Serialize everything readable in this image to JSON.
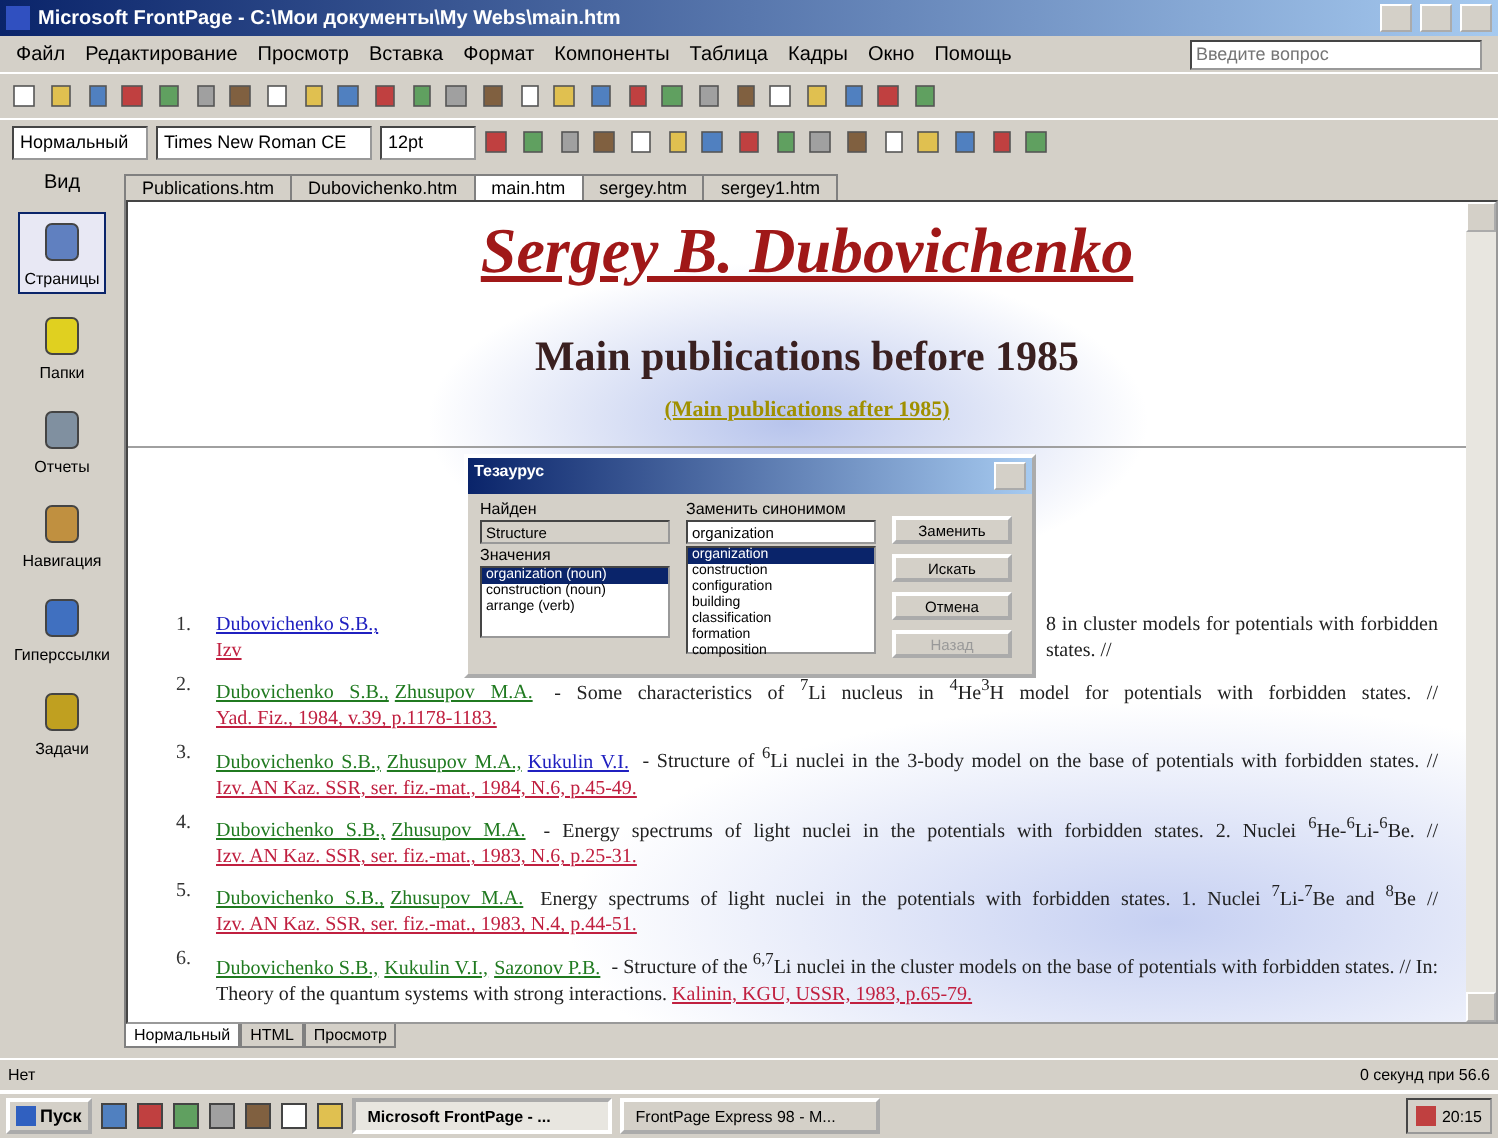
{
  "window": {
    "title": "Microsoft FrontPage - C:\\Мои документы\\My Webs\\main.htm"
  },
  "menu": [
    "Файл",
    "Редактирование",
    "Просмотр",
    "Вставка",
    "Формат",
    "Компоненты",
    "Таблица",
    "Кадры",
    "Окно",
    "Помощь"
  ],
  "help_field": {
    "placeholder": "Введите вопрос"
  },
  "format_bar": {
    "style": "Нормальный",
    "font": "Times New Roman CE",
    "size": "12pt"
  },
  "views": {
    "label": "Вид",
    "items": [
      {
        "label": "Страницы",
        "selected": true
      },
      {
        "label": "Папки",
        "selected": false
      },
      {
        "label": "Отчеты",
        "selected": false
      },
      {
        "label": "Навигация",
        "selected": false
      },
      {
        "label": "Гиперссылки",
        "selected": false
      },
      {
        "label": "Задачи",
        "selected": false
      }
    ]
  },
  "doc_tabs": [
    {
      "label": "Publications.htm",
      "selected": false
    },
    {
      "label": "Dubovichenko.htm",
      "selected": false
    },
    {
      "label": "main.htm",
      "selected": true
    },
    {
      "label": "sergey.htm",
      "selected": false
    },
    {
      "label": "sergey1.htm",
      "selected": false
    }
  ],
  "page": {
    "name": "Sergey B. Dubovichenko",
    "heading": "Main publications before 1985",
    "other_link": "(Main publications after 1985)",
    "items": [
      {
        "number": "1.",
        "authors": [
          {
            "text": "Dubovichenko S.B.,",
            "visited": false
          }
        ],
        "text": "8 in cluster models for potentials with forbidden states. //",
        "source": "Izv",
        "covered": true
      },
      {
        "number": "2.",
        "authors": [
          {
            "text": "Dubovichenko S.B.,",
            "visited": true
          },
          {
            "text": "Zhusupov M.A.",
            "visited": true
          }
        ],
        "text": "- Some characteristics of $^{7}$Li nucleus in $^{4}$He$^{3}$H model for potentials with forbidden states. //",
        "source": "Yad. Fiz., 1984, v.39, p.1178-1183.",
        "covered": false
      },
      {
        "number": "3.",
        "authors": [
          {
            "text": "Dubovichenko S.B.,",
            "visited": true
          },
          {
            "text": "Zhusupov M.A.,",
            "visited": true
          },
          {
            "text": "Kukulin V.I.",
            "visited": false
          }
        ],
        "text": "- Structure of $^{6}$Li nuclei in the 3-body model on the base of potentials with forbidden states. //",
        "source": "Izv. AN Kaz. SSR, ser. fiz.-mat., 1984, N.6, p.45-49.",
        "covered": false
      },
      {
        "number": "4.",
        "authors": [
          {
            "text": "Dubovichenko S.B.,",
            "visited": true
          },
          {
            "text": "Zhusupov M.A.",
            "visited": true
          }
        ],
        "text": "- Energy spectrums of light nuclei in the potentials with forbidden states. 2. Nuclei $^{6}$He-$^{6}$Li-$^{6}$Be. //",
        "source": "Izv. AN Kaz. SSR, ser. fiz.-mat., 1983, N.6, p.25-31.",
        "covered": false
      },
      {
        "number": "5.",
        "authors": [
          {
            "text": "Dubovichenko S.B.,",
            "visited": true
          },
          {
            "text": "Zhusupov M.A.",
            "visited": true
          }
        ],
        "text": "Energy spectrums of light nuclei in the potentials with forbidden states. 1. Nuclei $^{7}$Li-$^{7}$Be and $^{8}$Be //",
        "source": "Izv. AN Kaz. SSR, ser. fiz.-mat., 1983, N.4, p.44-51.",
        "covered": false
      },
      {
        "number": "6.",
        "authors": [
          {
            "text": "Dubovichenko S.B.,",
            "visited": true
          },
          {
            "text": "Kukulin V.I.,",
            "visited": true
          },
          {
            "text": "Sazonov P.B.",
            "visited": true
          }
        ],
        "text": "- Structure of the $^{6,7}$Li nuclei in the cluster models on the base of potentials with forbidden states. // In: Theory of the quantum systems with strong interactions.",
        "source": "Kalinin, KGU, USSR, 1983, p.65-79.",
        "covered": false
      }
    ]
  },
  "dialog": {
    "title": "Тезаурус",
    "looked_up_label": "Найден",
    "looked_up": "Structure",
    "meanings_label": "Значения",
    "meanings": [
      {
        "text": "organization (noun)",
        "selected": true
      },
      {
        "text": "construction (noun)",
        "selected": false
      },
      {
        "text": "arrange (verb)",
        "selected": false
      }
    ],
    "replace_label": "Заменить синонимом",
    "replace_value": "organization",
    "synonyms": [
      {
        "text": "organization",
        "selected": true
      },
      {
        "text": "construction",
        "selected": false
      },
      {
        "text": "configuration",
        "selected": false
      },
      {
        "text": "building",
        "selected": false
      },
      {
        "text": "classification",
        "selected": false
      },
      {
        "text": "formation",
        "selected": false
      },
      {
        "text": "composition",
        "selected": false
      }
    ],
    "buttons": [
      {
        "label": "Заменить",
        "disabled": false
      },
      {
        "label": "Искать",
        "disabled": false
      },
      {
        "label": "Отмена",
        "disabled": false
      },
      {
        "label": "Назад",
        "disabled": true
      }
    ]
  },
  "view_tabs": [
    {
      "label": "Нормальный",
      "selected": true
    },
    {
      "label": "HTML",
      "selected": false
    },
    {
      "label": "Просмотр",
      "selected": false
    }
  ],
  "status": {
    "left": "Нет",
    "right": "0 секунд при 56.6"
  },
  "taskbar": {
    "start": "Пуск",
    "tasks": [
      {
        "label": "Microsoft FrontPage - ...",
        "selected": true
      },
      {
        "label": "FrontPage Express 98 - M...",
        "selected": false
      }
    ],
    "clock": "20:15"
  }
}
